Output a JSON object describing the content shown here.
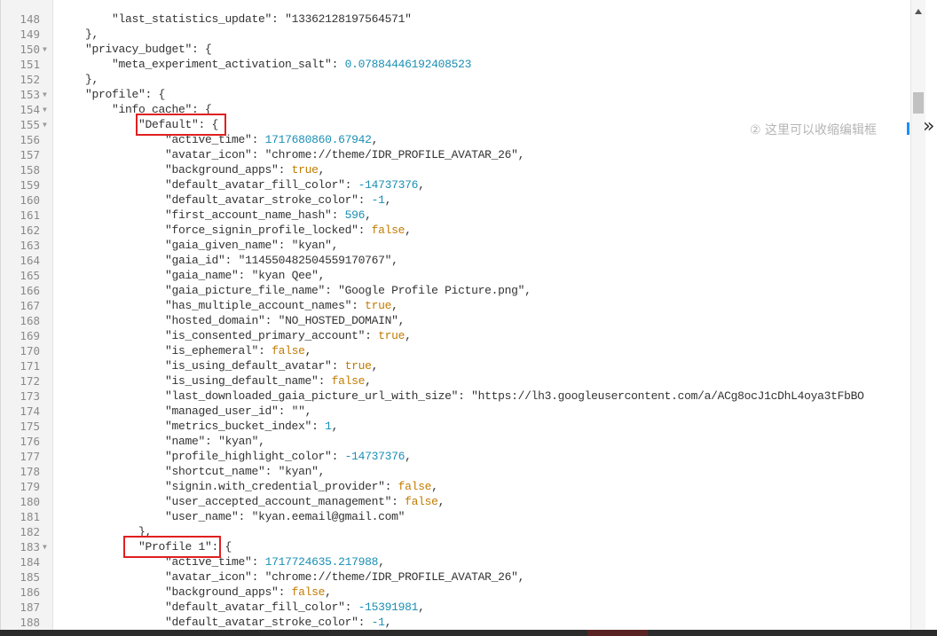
{
  "editor": {
    "lines": [
      {
        "n": "148",
        "fold": false,
        "html": "        <span class=\"s\">\"last_statistics_update\"</span>: <span class=\"s\">\"13362128197564571\"</span>"
      },
      {
        "n": "149",
        "fold": false,
        "html": "    },"
      },
      {
        "n": "150",
        "fold": true,
        "html": "    <span class=\"s\">\"privacy_budget\"</span>: {"
      },
      {
        "n": "151",
        "fold": false,
        "html": "        <span class=\"s\">\"meta_experiment_activation_salt\"</span>: <span class=\"n\">0.07884446192408523</span>"
      },
      {
        "n": "152",
        "fold": false,
        "html": "    },"
      },
      {
        "n": "153",
        "fold": true,
        "html": "    <span class=\"s\">\"profile\"</span>: {"
      },
      {
        "n": "154",
        "fold": true,
        "html": "        <span class=\"s\">\"info_cache\"</span>: {"
      },
      {
        "n": "155",
        "fold": true,
        "html": "            <span class=\"s\">\"Default\"</span>: {"
      },
      {
        "n": "156",
        "fold": false,
        "html": "                <span class=\"s\">\"active_time\"</span>: <span class=\"n\">1717680860.67942</span>,"
      },
      {
        "n": "157",
        "fold": false,
        "html": "                <span class=\"s\">\"avatar_icon\"</span>: <span class=\"s\">\"chrome://theme/IDR_PROFILE_AVATAR_26\"</span>,"
      },
      {
        "n": "158",
        "fold": false,
        "html": "                <span class=\"s\">\"background_apps\"</span>: <span class=\"b\">true</span>,"
      },
      {
        "n": "159",
        "fold": false,
        "html": "                <span class=\"s\">\"default_avatar_fill_color\"</span>: <span class=\"n\">-14737376</span>,"
      },
      {
        "n": "160",
        "fold": false,
        "html": "                <span class=\"s\">\"default_avatar_stroke_color\"</span>: <span class=\"n\">-1</span>,"
      },
      {
        "n": "161",
        "fold": false,
        "html": "                <span class=\"s\">\"first_account_name_hash\"</span>: <span class=\"n\">596</span>,"
      },
      {
        "n": "162",
        "fold": false,
        "html": "                <span class=\"s\">\"force_signin_profile_locked\"</span>: <span class=\"b\">false</span>,"
      },
      {
        "n": "163",
        "fold": false,
        "html": "                <span class=\"s\">\"gaia_given_name\"</span>: <span class=\"s\">\"kyan\"</span>,"
      },
      {
        "n": "164",
        "fold": false,
        "html": "                <span class=\"s\">\"gaia_id\"</span>: <span class=\"s\">\"114550482504559170767\"</span>,"
      },
      {
        "n": "165",
        "fold": false,
        "html": "                <span class=\"s\">\"gaia_name\"</span>: <span class=\"s\">\"kyan Qee\"</span>,"
      },
      {
        "n": "166",
        "fold": false,
        "html": "                <span class=\"s\">\"gaia_picture_file_name\"</span>: <span class=\"s\">\"Google Profile Picture.png\"</span>,"
      },
      {
        "n": "167",
        "fold": false,
        "html": "                <span class=\"s\">\"has_multiple_account_names\"</span>: <span class=\"b\">true</span>,"
      },
      {
        "n": "168",
        "fold": false,
        "html": "                <span class=\"s\">\"hosted_domain\"</span>: <span class=\"s\">\"NO_HOSTED_DOMAIN\"</span>,"
      },
      {
        "n": "169",
        "fold": false,
        "html": "                <span class=\"s\">\"is_consented_primary_account\"</span>: <span class=\"b\">true</span>,"
      },
      {
        "n": "170",
        "fold": false,
        "html": "                <span class=\"s\">\"is_ephemeral\"</span>: <span class=\"b\">false</span>,"
      },
      {
        "n": "171",
        "fold": false,
        "html": "                <span class=\"s\">\"is_using_default_avatar\"</span>: <span class=\"b\">true</span>,"
      },
      {
        "n": "172",
        "fold": false,
        "html": "                <span class=\"s\">\"is_using_default_name\"</span>: <span class=\"b\">false</span>,"
      },
      {
        "n": "173",
        "fold": false,
        "html": "                <span class=\"s\">\"last_downloaded_gaia_picture_url_with_size\"</span>: <span class=\"s\">\"https://lh3.googleusercontent.com/a/ACg8ocJ1cDhL4oya3tFbBO</span>"
      },
      {
        "n": "174",
        "fold": false,
        "html": "                <span class=\"s\">\"managed_user_id\"</span>: <span class=\"s\">\"\"</span>,"
      },
      {
        "n": "175",
        "fold": false,
        "html": "                <span class=\"s\">\"metrics_bucket_index\"</span>: <span class=\"n\">1</span>,"
      },
      {
        "n": "176",
        "fold": false,
        "html": "                <span class=\"s\">\"name\"</span>: <span class=\"s\">\"kyan\"</span>,"
      },
      {
        "n": "177",
        "fold": false,
        "html": "                <span class=\"s\">\"profile_highlight_color\"</span>: <span class=\"n\">-14737376</span>,"
      },
      {
        "n": "178",
        "fold": false,
        "html": "                <span class=\"s\">\"shortcut_name\"</span>: <span class=\"s\">\"kyan\"</span>,"
      },
      {
        "n": "179",
        "fold": false,
        "html": "                <span class=\"s\">\"signin.with_credential_provider\"</span>: <span class=\"b\">false</span>,"
      },
      {
        "n": "180",
        "fold": false,
        "html": "                <span class=\"s\">\"user_accepted_account_management\"</span>: <span class=\"b\">false</span>,"
      },
      {
        "n": "181",
        "fold": false,
        "html": "                <span class=\"s\">\"user_name\"</span>: <span class=\"s\">\"kyan.eemail@gmail.com\"</span>"
      },
      {
        "n": "182",
        "fold": false,
        "html": "            },"
      },
      {
        "n": "183",
        "fold": true,
        "html": "            <span class=\"s\">\"Profile 1\"</span>: {"
      },
      {
        "n": "184",
        "fold": false,
        "html": "                <span class=\"s\">\"active_time\"</span>: <span class=\"n\">1717724635.217988</span>,"
      },
      {
        "n": "185",
        "fold": false,
        "html": "                <span class=\"s\">\"avatar_icon\"</span>: <span class=\"s\">\"chrome://theme/IDR_PROFILE_AVATAR_26\"</span>,"
      },
      {
        "n": "186",
        "fold": false,
        "html": "                <span class=\"s\">\"background_apps\"</span>: <span class=\"b\">false</span>,"
      },
      {
        "n": "187",
        "fold": false,
        "html": "                <span class=\"s\">\"default_avatar_fill_color\"</span>: <span class=\"n\">-15391981</span>,"
      },
      {
        "n": "188",
        "fold": false,
        "html": "                <span class=\"s\">\"default_avatar_stroke_color\"</span>: <span class=\"n\">-1</span>,"
      }
    ]
  },
  "hint": {
    "text": "② 这里可以收缩编辑框",
    "collapse_icon": "»"
  },
  "colors": {
    "number": "#1a8fb5",
    "boolean": "#c27b00",
    "highlight_box": "#e02020",
    "hint_bar": "#1890ff"
  },
  "icons": [
    "fold-arrow-icon",
    "scroll-up-icon",
    "collapse-panel-icon"
  ]
}
